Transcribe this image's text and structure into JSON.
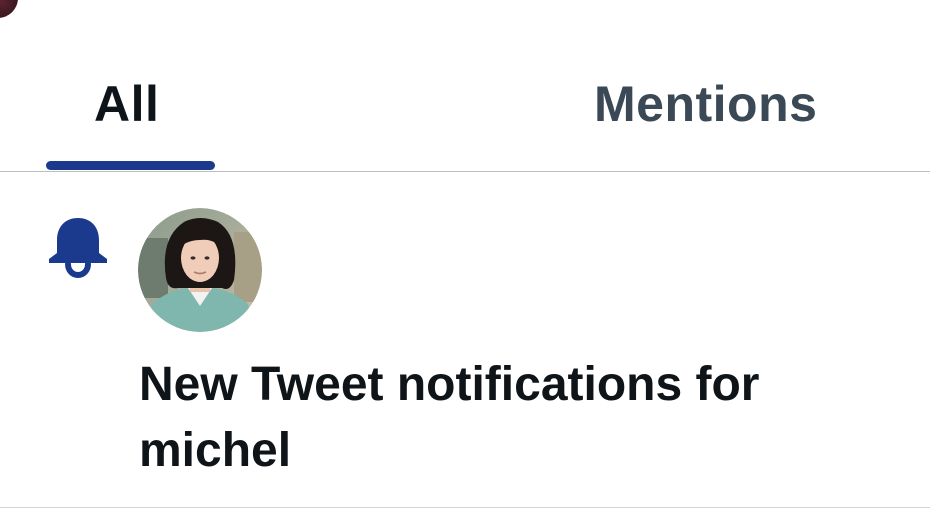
{
  "tabs": [
    {
      "label": "All",
      "selected": true
    },
    {
      "label": "Mentions",
      "selected": false
    }
  ],
  "notification": {
    "icon": "bell-icon",
    "avatar": "profile-photo",
    "text": "New Tweet notifications for michel"
  },
  "colors": {
    "accent": "#1b3a8e",
    "text_primary": "#0f1419",
    "text_secondary": "#3b4856",
    "divider": "#b9bfc5"
  }
}
